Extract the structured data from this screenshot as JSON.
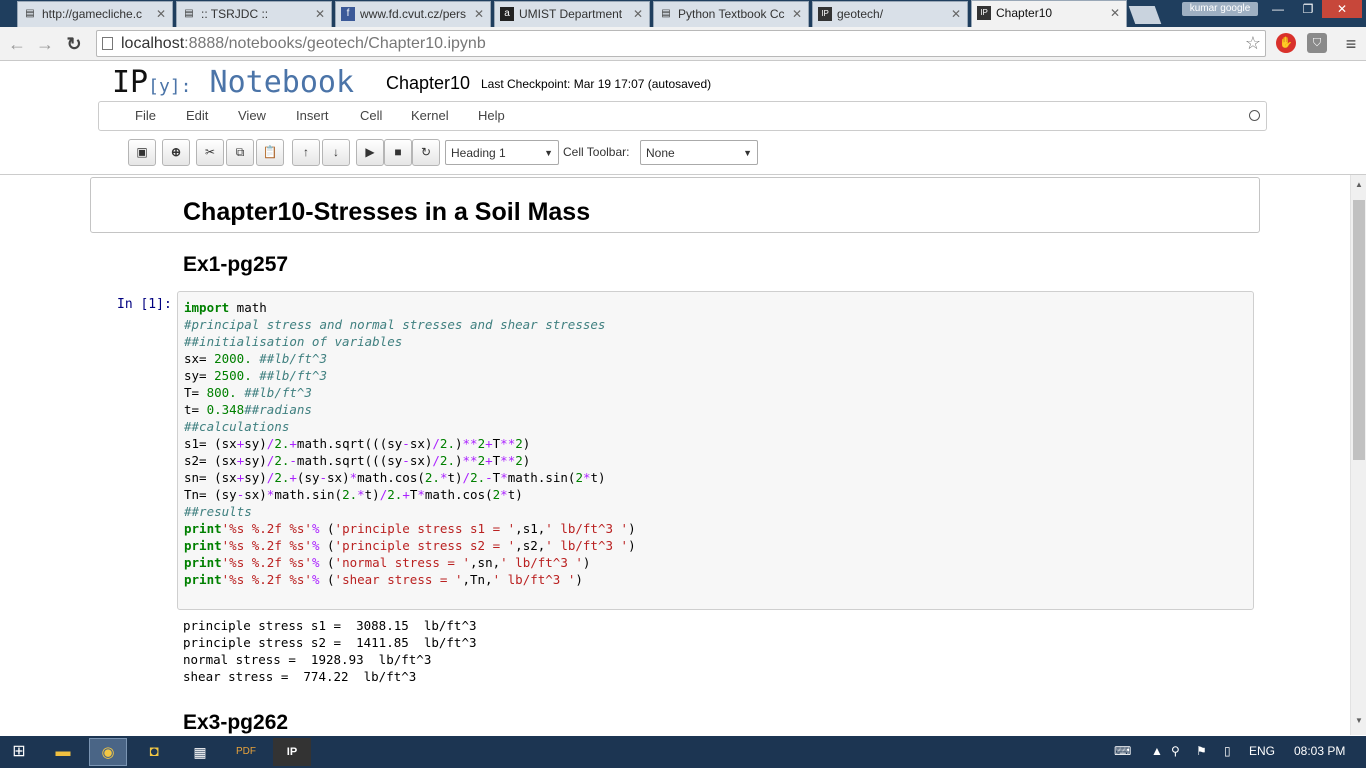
{
  "browser": {
    "tabs": [
      {
        "title": "http://gamecliche.c",
        "icon": "page-icon"
      },
      {
        "title": ":: TSRJDC ::",
        "icon": "page-icon"
      },
      {
        "title": "www.fd.cvut.cz/pers",
        "icon": "fb-icon"
      },
      {
        "title": "UMIST Department",
        "icon": "amazon-icon"
      },
      {
        "title": "Python Textbook Cc",
        "icon": "page-icon"
      },
      {
        "title": "geotech/",
        "icon": "ipython-icon"
      },
      {
        "title": "Chapter10",
        "icon": "ipython-icon"
      }
    ],
    "profile": "kumar google",
    "url_host": "localhost",
    "url_rest": ":8888/notebooks/geotech/Chapter10.ipynb"
  },
  "ipython": {
    "logo_ip": "IP",
    "logo_y": "[y]:",
    "logo_nb": "Notebook",
    "notebook_name": "Chapter10",
    "checkpoint": "Last Checkpoint: Mar 19 17:07 (autosaved)"
  },
  "menu": [
    "File",
    "Edit",
    "View",
    "Insert",
    "Cell",
    "Kernel",
    "Help"
  ],
  "toolbar": {
    "cell_type": "Heading 1",
    "cell_toolbar_label": "Cell Toolbar:",
    "cell_toolbar_value": "None"
  },
  "notebook": {
    "heading1": "Chapter10-Stresses in a Soil Mass",
    "ex1_heading": "Ex1-pg257",
    "prompt": "In [1]:",
    "code": [
      "import math",
      "#principal stress and normal stresses and shear stresses",
      "##initialisation of variables",
      "sx= 2000. ##lb/ft^3",
      "sy= 2500. ##lb/ft^3",
      "T= 800. ##lb/ft^3",
      "t= 0.348##radians",
      "##calculations",
      "s1= (sx+sy)/2.+math.sqrt(((sy-sx)/2.)**2+T**2)",
      "s2= (sx+sy)/2.-math.sqrt(((sy-sx)/2.)**2+T**2)",
      "sn= (sx+sy)/2.+(sy-sx)*math.cos(2.*t)/2.-T*math.sin(2*t)",
      "Tn= (sy-sx)*math.sin(2.*t)/2.+T*math.cos(2*t)",
      "##results",
      "print'%s %.2f %s'% ('principle stress s1 = ',s1,' lb/ft^3 ')",
      "print'%s %.2f %s'% ('principle stress s2 = ',s2,' lb/ft^3 ')",
      "print'%s %.2f %s'% ('normal stress = ',sn,' lb/ft^3 ')",
      "print'%s %.2f %s'% ('shear stress = ',Tn,' lb/ft^3 ')"
    ],
    "output": [
      "principle stress s1 =  3088.15  lb/ft^3",
      "principle stress s2 =  1411.85  lb/ft^3",
      "normal stress =  1928.93  lb/ft^3",
      "shear stress =  774.22  lb/ft^3"
    ],
    "ex3_heading": "Ex3-pg262"
  },
  "taskbar": {
    "lang": "ENG",
    "time": "08:03 PM"
  }
}
